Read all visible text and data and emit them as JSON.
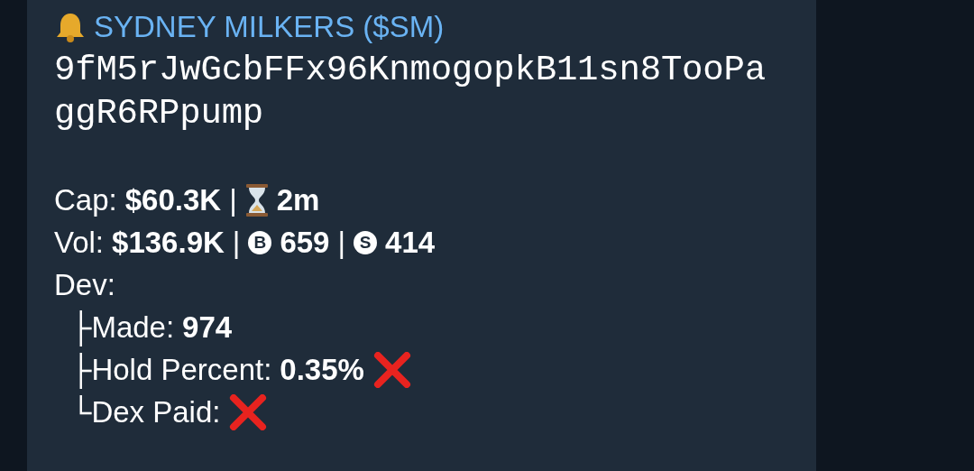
{
  "message": {
    "title": "SYDNEY MILKERS ($SM)",
    "address": "9fM5rJwGcbFFx96KnmogopkB11sn8TooPaggR6RPpump",
    "lines": [
      {
        "segments": [
          {
            "kind": "text",
            "text": "Cap:"
          },
          {
            "kind": "bold",
            "text": "$60.3K"
          },
          {
            "kind": "text",
            "text": "|"
          },
          {
            "kind": "hourglass"
          },
          {
            "kind": "bold",
            "text": "2m"
          }
        ]
      },
      {
        "segments": [
          {
            "kind": "text",
            "text": "Vol:"
          },
          {
            "kind": "bold",
            "text": "$136.9K"
          },
          {
            "kind": "text",
            "text": "|"
          },
          {
            "kind": "marker",
            "text": "B"
          },
          {
            "kind": "bold",
            "text": "659"
          },
          {
            "kind": "text",
            "text": "|"
          },
          {
            "kind": "marker",
            "text": "S"
          },
          {
            "kind": "bold",
            "text": "414"
          }
        ]
      },
      {
        "segments": [
          {
            "kind": "text",
            "text": "Dev:"
          }
        ],
        "children": [
          {
            "branch": "├",
            "segments": [
              {
                "kind": "text",
                "text": "Made:"
              },
              {
                "kind": "bold",
                "text": "974"
              }
            ]
          },
          {
            "branch": "├",
            "segments": [
              {
                "kind": "text",
                "text": "Hold Percent:"
              },
              {
                "kind": "bold",
                "text": "0.35%"
              },
              {
                "kind": "cross"
              }
            ]
          },
          {
            "branch": "└",
            "segments": [
              {
                "kind": "text",
                "text": "Dex Paid:"
              },
              {
                "kind": "cross"
              }
            ]
          }
        ]
      }
    ]
  }
}
